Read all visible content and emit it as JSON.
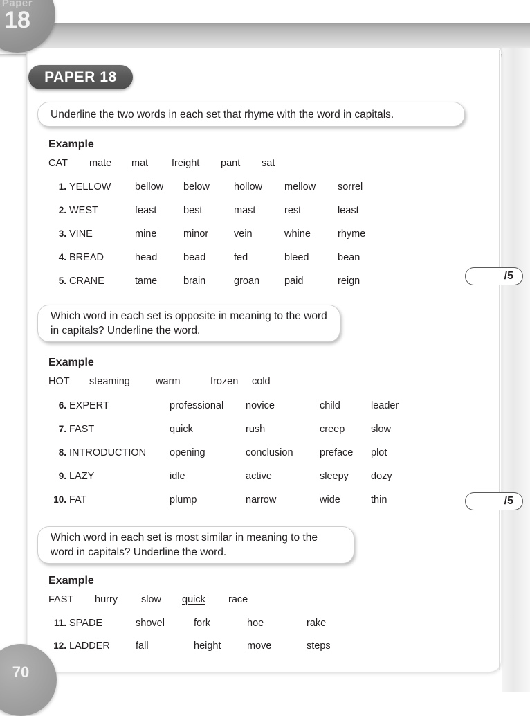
{
  "book": {
    "corner_tab_top": {
      "word": "Paper",
      "number": "18"
    },
    "page_number": "70",
    "paper_badge": "PAPER 18"
  },
  "sections": [
    {
      "instruction": "Underline the two words in each set that rhyme with the word in capitals.",
      "example_heading": "Example",
      "example_row": {
        "head": "CAT",
        "options": [
          "mate",
          "mat",
          "freight",
          "pant",
          "sat"
        ],
        "underlined": [
          "mat",
          "sat"
        ]
      },
      "questions": [
        {
          "number": "1.",
          "head": "YELLOW",
          "options": [
            "bellow",
            "below",
            "hollow",
            "mellow",
            "sorrel"
          ]
        },
        {
          "number": "2.",
          "head": "WEST",
          "options": [
            "feast",
            "best",
            "mast",
            "rest",
            "least"
          ]
        },
        {
          "number": "3.",
          "head": "VINE",
          "options": [
            "mine",
            "minor",
            "vein",
            "whine",
            "rhyme"
          ]
        },
        {
          "number": "4.",
          "head": "BREAD",
          "options": [
            "head",
            "bead",
            "fed",
            "bleed",
            "bean"
          ]
        },
        {
          "number": "5.",
          "head": "CRANE",
          "options": [
            "tame",
            "brain",
            "groan",
            "paid",
            "reign"
          ]
        }
      ],
      "score": "/5"
    },
    {
      "instruction": "Which word in each set is opposite in meaning to the word in capitals? Underline the word.",
      "example_heading": "Example",
      "example_row": {
        "head": "HOT",
        "options": [
          "steaming",
          "warm",
          "frozen",
          "cold"
        ],
        "underlined": [
          "cold"
        ]
      },
      "questions": [
        {
          "number": "6.",
          "head": "EXPERT",
          "options": [
            "professional",
            "novice",
            "child",
            "leader"
          ]
        },
        {
          "number": "7.",
          "head": "FAST",
          "options": [
            "quick",
            "rush",
            "creep",
            "slow"
          ]
        },
        {
          "number": "8.",
          "head": "INTRODUCTION",
          "options": [
            "opening",
            "conclusion",
            "preface",
            "plot"
          ]
        },
        {
          "number": "9.",
          "head": "LAZY",
          "options": [
            "idle",
            "active",
            "sleepy",
            "dozy"
          ]
        },
        {
          "number": "10.",
          "head": "FAT",
          "options": [
            "plump",
            "narrow",
            "wide",
            "thin"
          ]
        }
      ],
      "score": "/5"
    },
    {
      "instruction": "Which word in each set is most similar in meaning to the word in capitals? Underline the word.",
      "example_heading": "Example",
      "example_row": {
        "head": "FAST",
        "options": [
          "hurry",
          "slow",
          "quick",
          "race"
        ],
        "underlined": [
          "quick"
        ]
      },
      "questions": [
        {
          "number": "11.",
          "head": "SPADE",
          "options": [
            "shovel",
            "fork",
            "hoe",
            "rake"
          ]
        },
        {
          "number": "12.",
          "head": "LADDER",
          "options": [
            "fall",
            "height",
            "move",
            "steps"
          ]
        }
      ],
      "score": ""
    }
  ]
}
